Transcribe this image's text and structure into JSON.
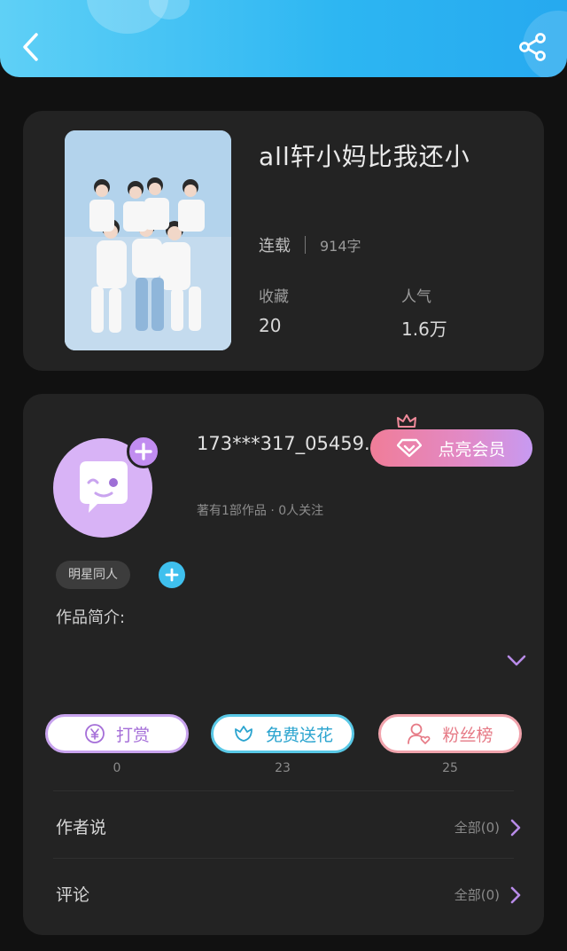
{
  "header": {
    "back_icon": "chevron-left-icon",
    "share_icon": "share-icon"
  },
  "book": {
    "title": "all轩小妈比我还小",
    "status": "连载",
    "word_count": "914字",
    "favorites_label": "收藏",
    "favorites_value": "20",
    "popularity_label": "人气",
    "popularity_value": "1.6万"
  },
  "author": {
    "name": "173***317_05459...",
    "meta": "著有1部作品 · 0人关注",
    "vip_label": "点亮会员",
    "add_icon": "plus-icon"
  },
  "tags": [
    "明星同人"
  ],
  "intro_label": "作品简介:",
  "actions": [
    {
      "label": "打赏",
      "count": "0",
      "icon": "yen-icon",
      "color": "#a56fd8"
    },
    {
      "label": "免费送花",
      "count": "23",
      "icon": "flower-icon",
      "color": "#2ba4cf"
    },
    {
      "label": "粉丝榜",
      "count": "25",
      "icon": "user-heart-icon",
      "color": "#e67a86"
    }
  ],
  "sections": [
    {
      "label": "作者说",
      "more": "全部(0)"
    },
    {
      "label": "评论",
      "more": "全部(0)"
    }
  ],
  "colors": {
    "header_gradient_start": "#5fd0f6",
    "header_gradient_end": "#26a9ef",
    "card_bg": "#232323",
    "page_bg": "#111111",
    "accent_purple": "#c18df0"
  }
}
